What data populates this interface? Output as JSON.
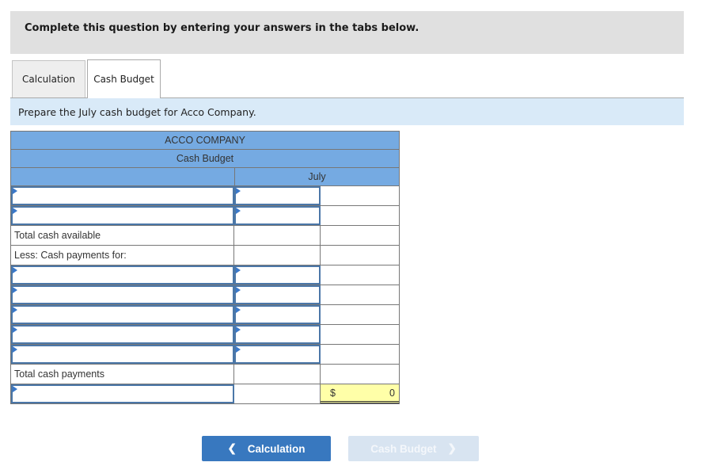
{
  "banner": {
    "text": "Complete this question by entering your answers in the tabs below."
  },
  "tabs": [
    {
      "label": "Calculation",
      "active": false
    },
    {
      "label": "Cash Budget",
      "active": true
    }
  ],
  "instruction": "Prepare the July cash budget for Acco Company.",
  "sheet": {
    "company": "ACCO COMPANY",
    "title": "Cash Budget",
    "column": "July",
    "labels": {
      "total_cash_available": "Total cash available",
      "less_cash_payments": "Less: Cash payments for:",
      "total_cash_payments": "Total cash payments"
    },
    "final_row": {
      "currency": "$",
      "value": "0"
    }
  },
  "nav": {
    "prev_label": "Calculation",
    "next_label": "Cash Budget",
    "prev_icon": "chevron-left-icon",
    "next_icon": "chevron-right-icon"
  }
}
